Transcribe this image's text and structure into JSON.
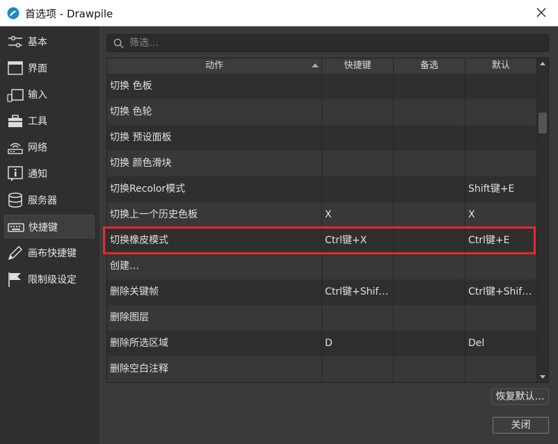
{
  "window": {
    "title": "首选项 - Drawpile"
  },
  "sidebar": {
    "items": [
      {
        "label": "基本",
        "icon": "sliders-icon"
      },
      {
        "label": "界面",
        "icon": "window-icon"
      },
      {
        "label": "输入",
        "icon": "tablet-icon"
      },
      {
        "label": "工具",
        "icon": "toolbox-icon"
      },
      {
        "label": "网络",
        "icon": "router-icon"
      },
      {
        "label": "通知",
        "icon": "info-icon"
      },
      {
        "label": "服务器",
        "icon": "database-icon"
      },
      {
        "label": "快捷键",
        "icon": "keyboard-icon"
      },
      {
        "label": "画布快捷键",
        "icon": "pencil-icon"
      },
      {
        "label": "限制级设定",
        "icon": "flag-icon"
      }
    ],
    "active_index": 7
  },
  "search": {
    "placeholder": "筛选…"
  },
  "table": {
    "headers": {
      "action": "动作",
      "shortcut": "快捷键",
      "alternate": "备选",
      "default": "默认"
    },
    "rows": [
      {
        "action": "切换 色板",
        "shortcut": "",
        "alternate": "",
        "default": ""
      },
      {
        "action": "切换 色轮",
        "shortcut": "",
        "alternate": "",
        "default": ""
      },
      {
        "action": "切换 预设面板",
        "shortcut": "",
        "alternate": "",
        "default": ""
      },
      {
        "action": "切换 颜色滑块",
        "shortcut": "",
        "alternate": "",
        "default": ""
      },
      {
        "action": "切换Recolor模式",
        "shortcut": "",
        "alternate": "",
        "default": "Shift键+E"
      },
      {
        "action": "切换上一个历史色板",
        "shortcut": "X",
        "alternate": "",
        "default": "X"
      },
      {
        "action": "切换橡皮模式",
        "shortcut": "Ctrl键+X",
        "alternate": "",
        "default": "Ctrl键+E"
      },
      {
        "action": "创建…",
        "shortcut": "",
        "alternate": "",
        "default": ""
      },
      {
        "action": "删除关键帧",
        "shortcut": "Ctrl键+Shif…",
        "alternate": "",
        "default": "Ctrl键+Shif…"
      },
      {
        "action": "删除图层",
        "shortcut": "",
        "alternate": "",
        "default": ""
      },
      {
        "action": "删除所选区域",
        "shortcut": "D",
        "alternate": "",
        "default": "Del"
      },
      {
        "action": "删除空白注释",
        "shortcut": "",
        "alternate": "",
        "default": ""
      }
    ],
    "highlight_color": "#e8282c"
  },
  "buttons": {
    "restore_defaults": "恢复默认…",
    "close": "关闭"
  }
}
